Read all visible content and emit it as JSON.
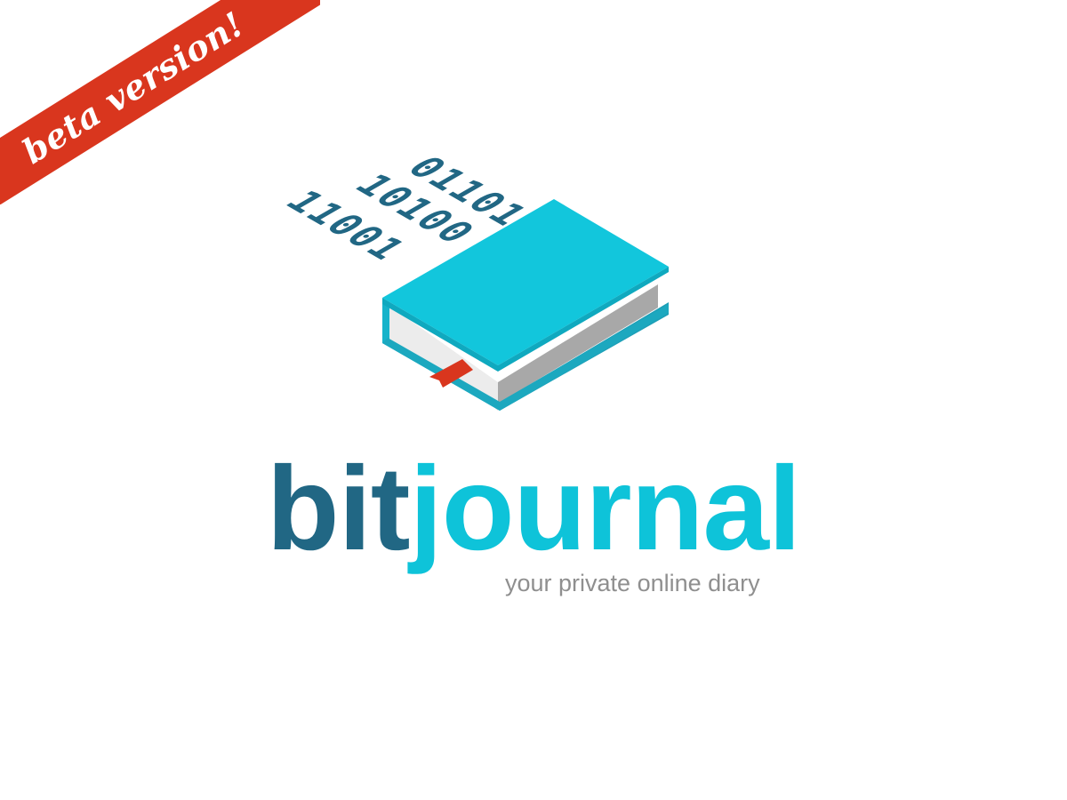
{
  "ribbon": {
    "label": "beta version!",
    "color": "#d9361e"
  },
  "book": {
    "icon": "binary-book-icon",
    "binary_rows": [
      "01101",
      "10100",
      "11001"
    ],
    "cover_color": "#12c6dc",
    "digit_color": "#216784",
    "bookmark_color": "#d9361e"
  },
  "brand": {
    "part1": "bit",
    "part2": "journal",
    "part1_color": "#216784",
    "part2_color": "#0ec3d9"
  },
  "tagline": "your private online diary"
}
